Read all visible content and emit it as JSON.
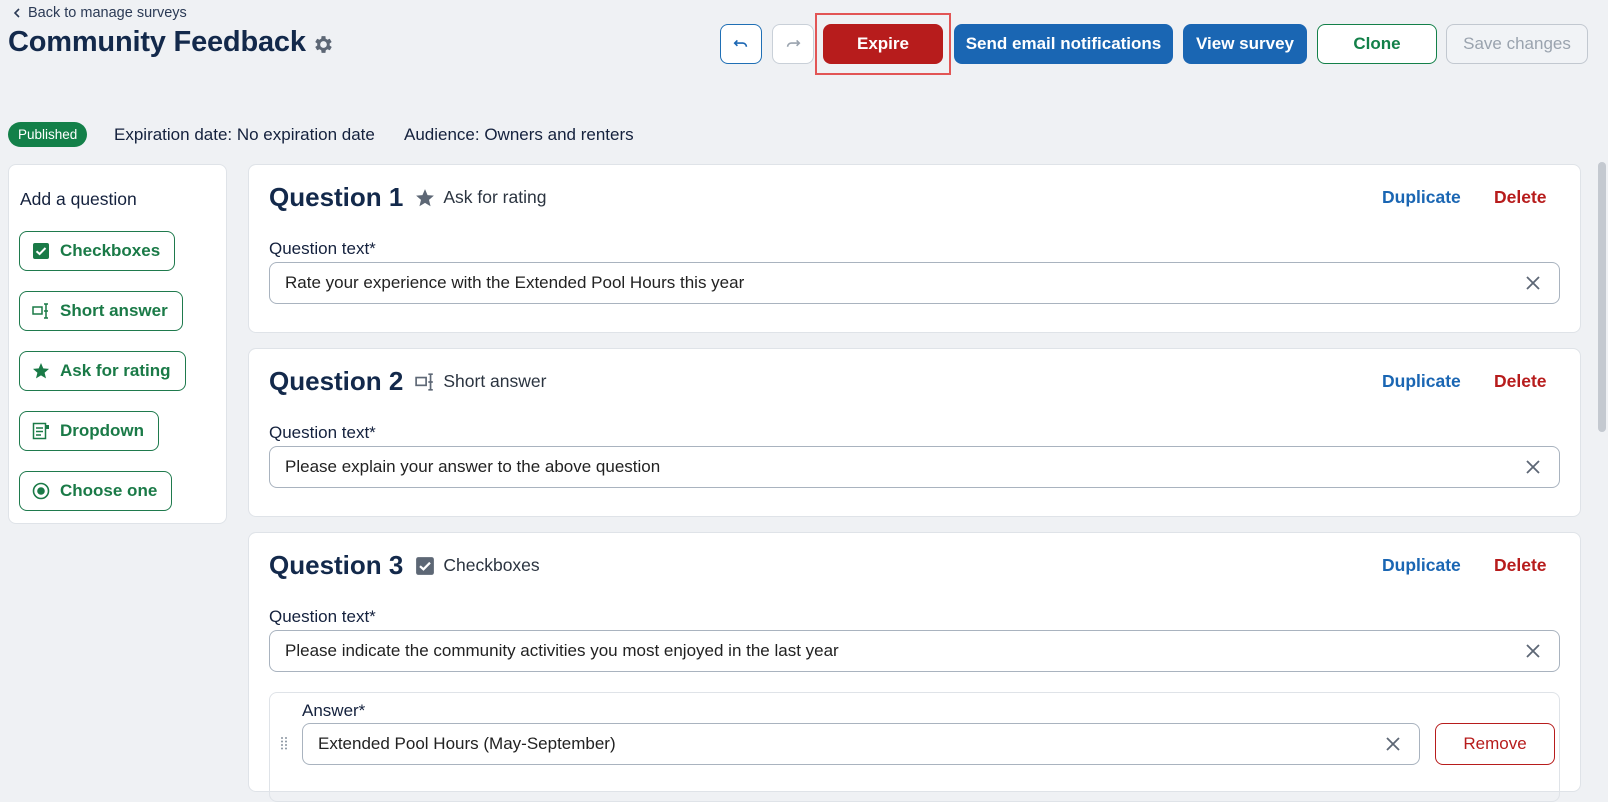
{
  "nav": {
    "back_label": "Back to manage surveys"
  },
  "header": {
    "title": "Community Feedback"
  },
  "toolbar": {
    "undo_icon": "undo-icon",
    "redo_icon": "redo-icon",
    "expire_label": "Expire",
    "send_label": "Send email notifications",
    "view_label": "View survey",
    "clone_label": "Clone",
    "save_label": "Save changes"
  },
  "status": {
    "badge": "Published",
    "expiration": "Expiration date: No expiration date",
    "audience": "Audience: Owners and renters"
  },
  "sidebar": {
    "title": "Add a question",
    "items": [
      {
        "label": "Checkboxes",
        "icon": "checkbox-icon"
      },
      {
        "label": "Short answer",
        "icon": "text-cursor-icon"
      },
      {
        "label": "Ask for rating",
        "icon": "star-icon"
      },
      {
        "label": "Dropdown",
        "icon": "dropdown-icon"
      },
      {
        "label": "Choose one",
        "icon": "radio-icon"
      }
    ]
  },
  "questions": [
    {
      "number": "Question 1",
      "type": "Ask for rating",
      "text_label": "Question text*",
      "text": "Rate your experience with the Extended Pool Hours this year"
    },
    {
      "number": "Question 2",
      "type": "Short answer",
      "text_label": "Question text*",
      "text": "Please explain your answer to the above question"
    },
    {
      "number": "Question 3",
      "type": "Checkboxes",
      "text_label": "Question text*",
      "text": "Please indicate the community activities you most enjoyed in the last year",
      "answers": [
        {
          "label": "Answer*",
          "value": "Extended Pool Hours (May-September)",
          "remove_label": "Remove"
        }
      ]
    }
  ],
  "actions": {
    "duplicate_label": "Duplicate",
    "delete_label": "Delete"
  },
  "colors": {
    "primary_blue": "#1a66b3",
    "danger_red": "#b71c1c",
    "success_green": "#138049",
    "title_navy": "#13294b",
    "background": "#eff1f4"
  }
}
